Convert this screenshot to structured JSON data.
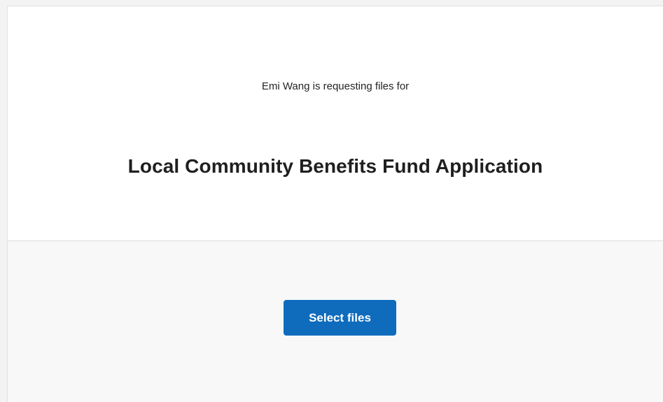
{
  "request": {
    "requester_line": "Emi Wang is requesting files for",
    "title": "Local Community Benefits Fund Application"
  },
  "actions": {
    "select_files_label": "Select files"
  },
  "colors": {
    "accent": "#0f6cbd",
    "page_background": "#f3f3f3",
    "action_background": "#f8f8f8"
  }
}
